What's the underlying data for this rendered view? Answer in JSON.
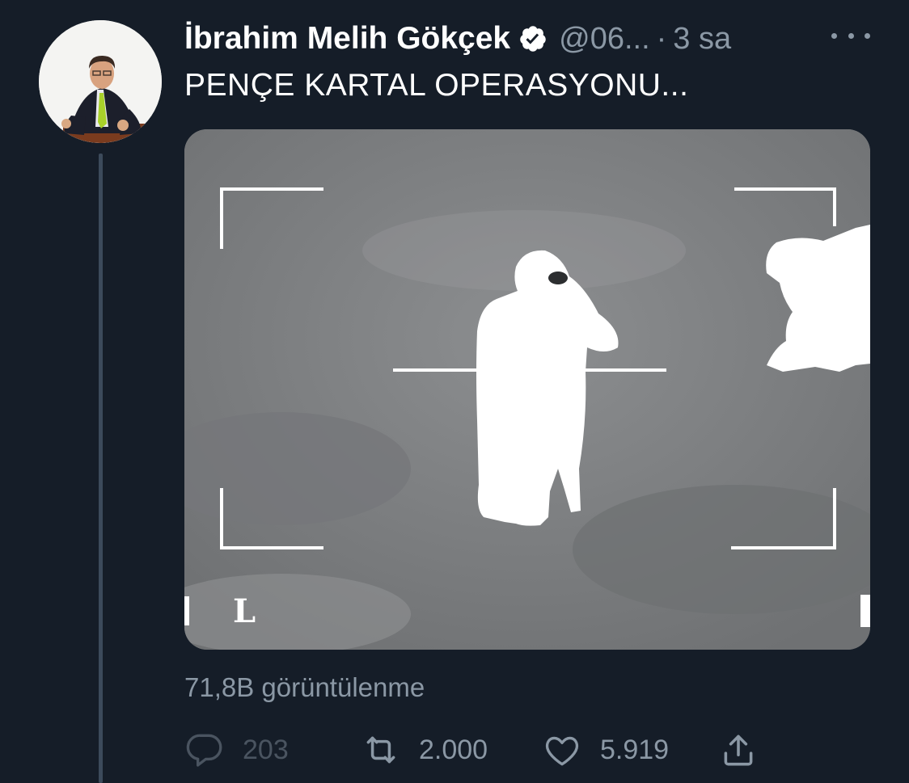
{
  "author": {
    "name": "İbrahim Melih Gökçek",
    "handle": "@06...",
    "separator": "·",
    "time": "3 sa",
    "verified": true
  },
  "tweet": {
    "text": "PENÇE KARTAL OPERASYONU..."
  },
  "media": {
    "overlay_left_label": "L"
  },
  "stats": {
    "views": "71,8B görüntülenme"
  },
  "actions": {
    "reply_count": "203",
    "retweet_count": "2.000",
    "like_count": "5.919"
  },
  "icons": [
    "verified-badge-icon",
    "more-icon",
    "reply-icon",
    "retweet-icon",
    "like-icon",
    "share-icon"
  ],
  "colors": {
    "background": "#151d28",
    "text_primary": "#ffffff",
    "text_secondary": "#8b98a5",
    "thread_line": "#3c4a5b"
  }
}
